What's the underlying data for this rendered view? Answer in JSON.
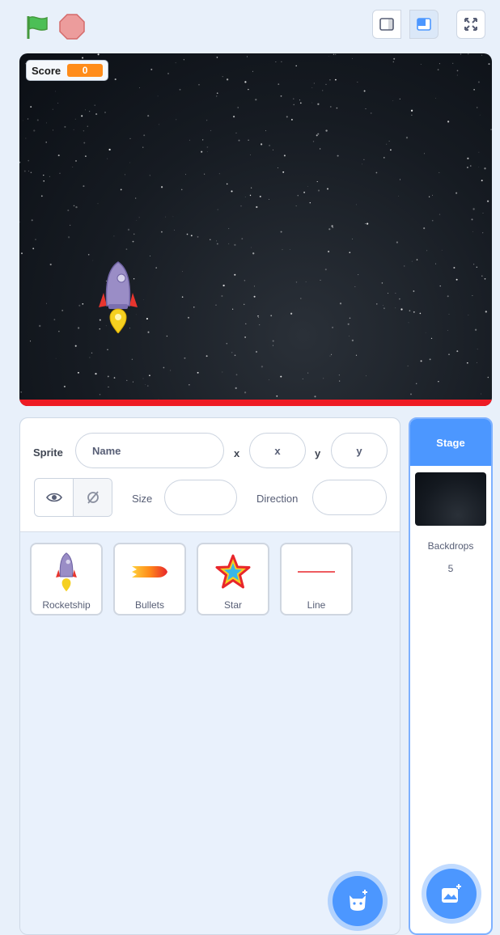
{
  "toolbar": {
    "green_flag": "green-flag-icon",
    "stop": "stop-icon",
    "small_stage": "small-stage-icon",
    "normal_stage": "normal-stage-icon",
    "fullscreen": "fullscreen-icon"
  },
  "stage": {
    "monitor_label": "Score",
    "monitor_value": "0",
    "accent_color": "#ff8c1a",
    "bottom_line_color": "#ee1b24"
  },
  "sprite_info": {
    "sprite_label": "Sprite",
    "name_placeholder": "Name",
    "x_label": "x",
    "x_placeholder": "x",
    "y_label": "y",
    "y_placeholder": "y",
    "show_label": "show-icon",
    "hide_label": "hide-icon",
    "size_label": "Size",
    "direction_label": "Direction"
  },
  "sprites": [
    {
      "label": "Rocketship",
      "icon": "rocketship-icon"
    },
    {
      "label": "Bullets",
      "icon": "bullets-icon"
    },
    {
      "label": "Star",
      "icon": "star-icon"
    },
    {
      "label": "Line",
      "icon": "line-icon"
    }
  ],
  "stage_selector": {
    "header": "Stage",
    "backdrops_label": "Backdrops",
    "backdrops_count": "5"
  },
  "colors": {
    "primary": "#4c97ff",
    "flag": "#4cbf56",
    "stop": "#ec9c9c"
  }
}
